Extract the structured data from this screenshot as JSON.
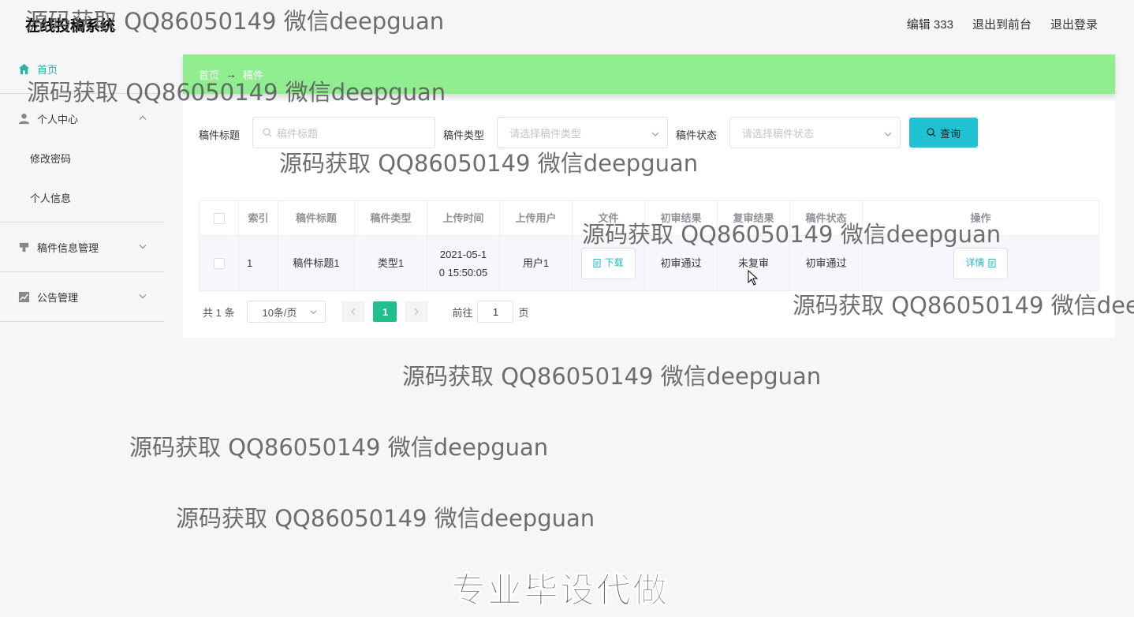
{
  "header": {
    "app_title": "在线投稿系统",
    "user_label": "编辑 333",
    "front_label": "退出到前台",
    "logout_label": "退出登录"
  },
  "sidebar": {
    "home": "首页",
    "personal_center": "个人中心",
    "change_password": "修改密码",
    "personal_info": "个人信息",
    "manuscript_mgmt": "稿件信息管理",
    "notice_mgmt": "公告管理"
  },
  "breadcrumb": {
    "home": "首页",
    "arrow": "→",
    "current": "稿件"
  },
  "filters": {
    "title_label": "稿件标题",
    "title_placeholder": "稿件标题",
    "type_label": "稿件类型",
    "type_placeholder": "请选择稿件类型",
    "status_label": "稿件状态",
    "status_placeholder": "请选择稿件状态",
    "query_label": "查询"
  },
  "table": {
    "headers": {
      "index": "索引",
      "title": "稿件标题",
      "type": "稿件类型",
      "upload_time": "上传时间",
      "uploader": "上传用户",
      "file": "文件",
      "first_review": "初审结果",
      "second_review": "复审结果",
      "status": "稿件状态",
      "action": "操作"
    },
    "rows": [
      {
        "index": "1",
        "title": "稿件标题1",
        "type": "类型1",
        "upload_time_line1": "2021-05-1",
        "upload_time_line2": "0 15:50:05",
        "uploader": "用户1",
        "file_button": "下载",
        "first_review": "初审通过",
        "second_review": "未复审",
        "status": "初审通过",
        "detail_button": "详情"
      }
    ]
  },
  "pagination": {
    "total": "共 1 条",
    "page_size": "10条/页",
    "current_page": "1",
    "goto_label": "前往",
    "goto_value": "1",
    "page_suffix": "页"
  },
  "watermark": "源码获取 QQ86050149 微信deepguan",
  "promo": "专业毕设代做"
}
